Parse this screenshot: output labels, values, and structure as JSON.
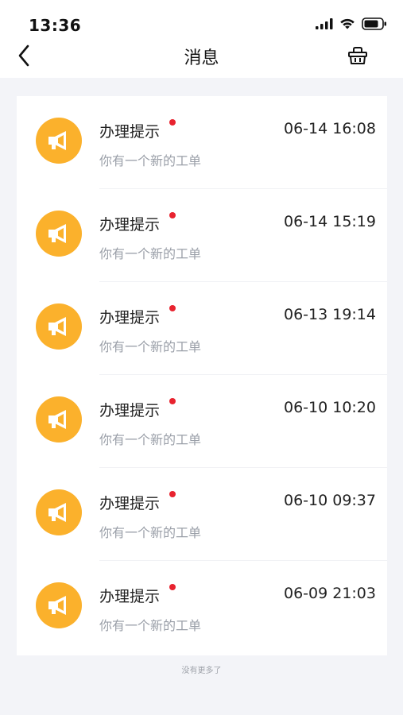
{
  "status_bar": {
    "time": "13:36"
  },
  "nav": {
    "title": "消息",
    "back_icon": "chevron-left-icon",
    "clear_icon": "basket-icon"
  },
  "messages": [
    {
      "title": "办理提示",
      "subtitle": "你有一个新的工单",
      "time": "06-14 16:08",
      "unread": true
    },
    {
      "title": "办理提示",
      "subtitle": "你有一个新的工单",
      "time": "06-14 15:19",
      "unread": true
    },
    {
      "title": "办理提示",
      "subtitle": "你有一个新的工单",
      "time": "06-13 19:14",
      "unread": true
    },
    {
      "title": "办理提示",
      "subtitle": "你有一个新的工单",
      "time": "06-10 10:20",
      "unread": true
    },
    {
      "title": "办理提示",
      "subtitle": "你有一个新的工单",
      "time": "06-10 09:37",
      "unread": true
    },
    {
      "title": "办理提示",
      "subtitle": "你有一个新的工单",
      "time": "06-09 21:03",
      "unread": true
    }
  ],
  "footer": {
    "text": "没有更多了"
  },
  "colors": {
    "accent": "#FBB12C",
    "unread_dot": "#E8232F",
    "background": "#F3F4F8"
  }
}
